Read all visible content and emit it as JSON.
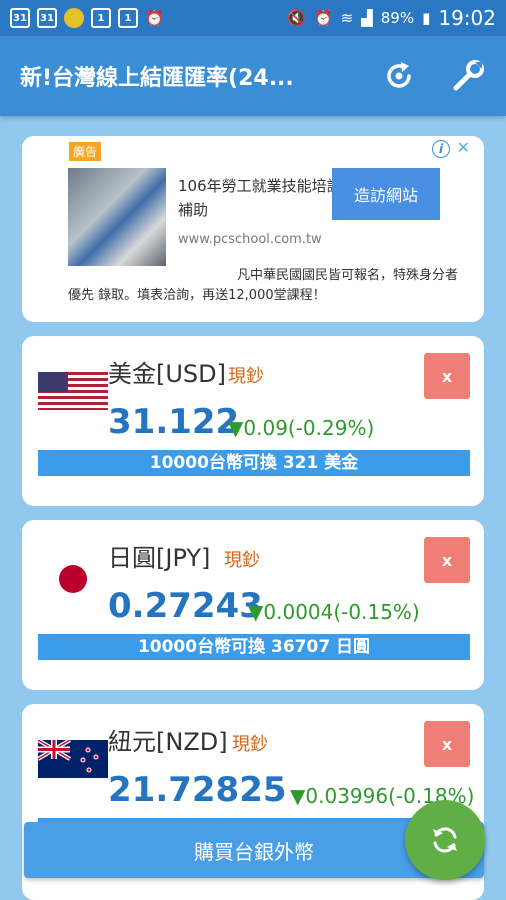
{
  "status_bar": {
    "left_icons": [
      "31",
      "31",
      "",
      "1",
      "1",
      "alarm-icon"
    ],
    "battery": "89%",
    "time": "19:02"
  },
  "app_bar": {
    "title": "新!台灣線上結匯匯率(24...",
    "actions": [
      "refresh-icon",
      "wrench-icon"
    ]
  },
  "ad": {
    "badge": "廣告",
    "title": "106年勞工就業技能培訓補助",
    "url": "www.pcschool.com.tw",
    "button": "造訪網站",
    "desc_line1": "凡中華民國國民皆可報名，特殊身分者",
    "desc_line2": "優先 錄取。填表洽詢，再送12,000堂課程！"
  },
  "currencies": [
    {
      "name": "美金[USD]",
      "type": "現鈔",
      "rate": "31.122",
      "change": "▼0.09(-0.29%)",
      "conversion": "10000台幣可換 321 美金",
      "remove_label": "x"
    },
    {
      "name": "日圓[JPY]",
      "type": "現鈔",
      "rate": "0.27243",
      "change": "▼0.0004(-0.15%)",
      "conversion": "10000台幣可換 36707 日圓",
      "remove_label": "x"
    },
    {
      "name": "紐元[NZD]",
      "type": "現鈔",
      "rate": "21.72825",
      "change": "▼0.03996(-0.18%)",
      "conversion": "",
      "remove_label": "x"
    }
  ],
  "buy_button": "購買台銀外幣",
  "colors": {
    "status_bar": "#2a78c4",
    "app_bar": "#3b8ed6",
    "background": "#90c8ee",
    "rate": "#2574c0",
    "change_down": "#2e9a2e",
    "conversion_bar": "#3c9cec",
    "remove": "#ef7f76",
    "fab": "#5fae46"
  }
}
